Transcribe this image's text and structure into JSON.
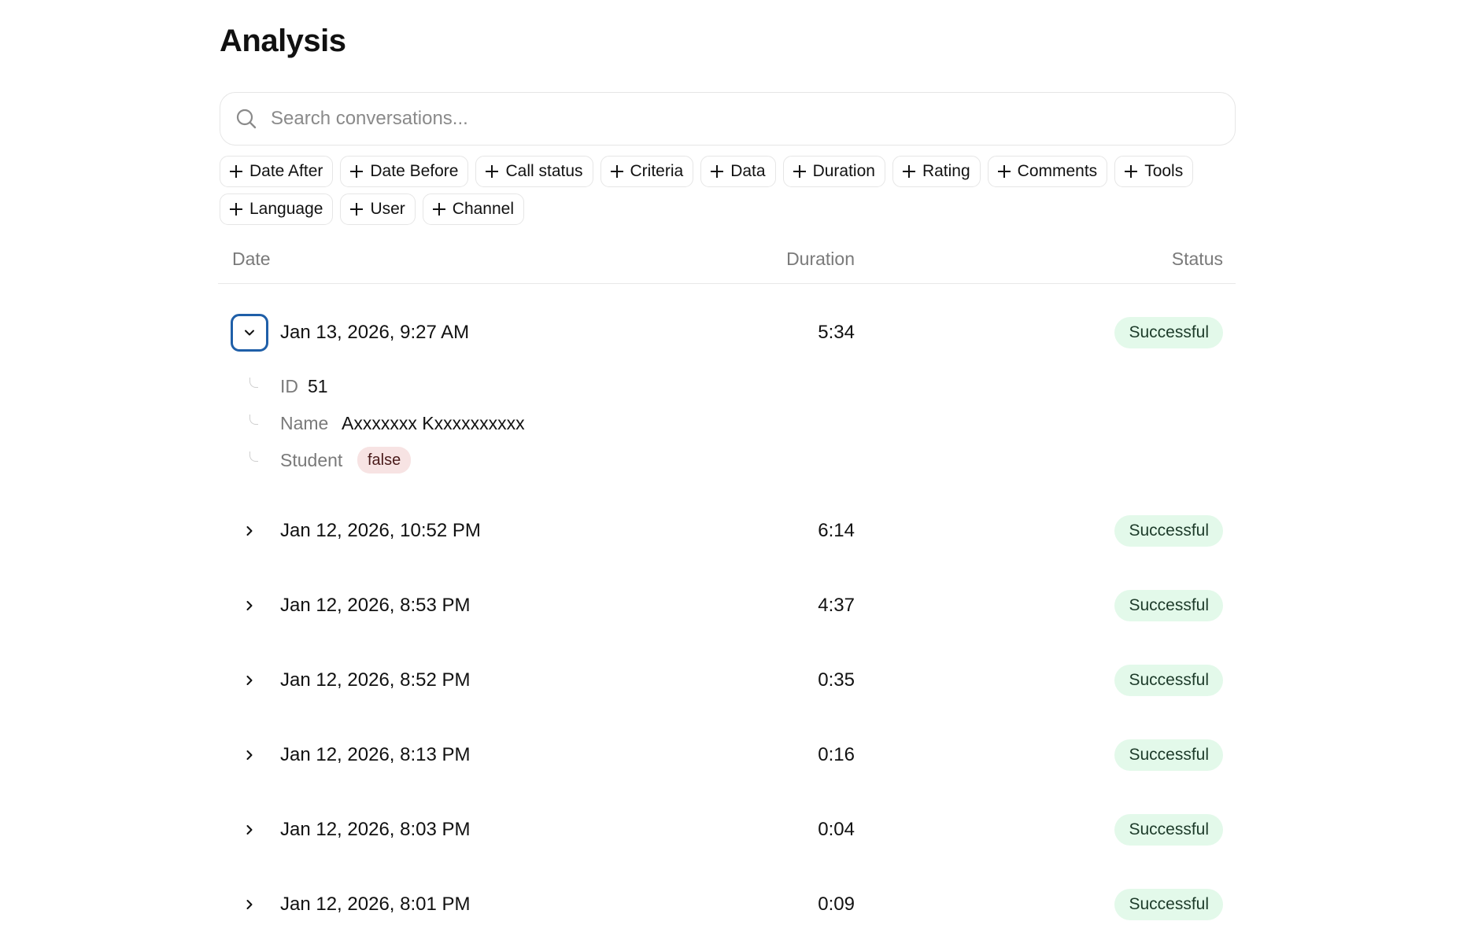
{
  "page": {
    "title": "Analysis"
  },
  "search": {
    "placeholder": "Search conversations...",
    "value": ""
  },
  "filters": {
    "row1": [
      "Date After",
      "Date Before",
      "Call status",
      "Criteria",
      "Data",
      "Duration",
      "Rating",
      "Comments",
      "Tools"
    ],
    "row2": [
      "Language",
      "User",
      "Channel"
    ]
  },
  "table": {
    "headers": {
      "date": "Date",
      "duration": "Duration",
      "status": "Status"
    },
    "rows": [
      {
        "date": "Jan 13, 2026, 9:27 AM",
        "duration": "5:34",
        "status": "Successful",
        "expanded": true
      },
      {
        "date": "Jan 12, 2026, 10:52 PM",
        "duration": "6:14",
        "status": "Successful",
        "expanded": false
      },
      {
        "date": "Jan 12, 2026, 8:53 PM",
        "duration": "4:37",
        "status": "Successful",
        "expanded": false
      },
      {
        "date": "Jan 12, 2026, 8:52 PM",
        "duration": "0:35",
        "status": "Successful",
        "expanded": false
      },
      {
        "date": "Jan 12, 2026, 8:13 PM",
        "duration": "0:16",
        "status": "Successful",
        "expanded": false
      },
      {
        "date": "Jan 12, 2026, 8:03 PM",
        "duration": "0:04",
        "status": "Successful",
        "expanded": false
      },
      {
        "date": "Jan 12, 2026, 8:01 PM",
        "duration": "0:09",
        "status": "Successful",
        "expanded": false
      }
    ],
    "expanded_details": {
      "id_label": "ID",
      "id_value": "51",
      "name_label": "Name",
      "name_value": "Axxxxxxx Kxxxxxxxxxx",
      "student_label": "Student",
      "student_value": "false"
    }
  },
  "colors": {
    "success_badge_bg": "#e3f9ea",
    "false_badge_bg": "#f7e3e3",
    "focus_ring": "#1f5fa8"
  },
  "icons": {
    "search": "search-icon",
    "chevron_down": "chevron-down-icon",
    "chevron_right": "chevron-right-icon",
    "plus": "plus-icon"
  }
}
